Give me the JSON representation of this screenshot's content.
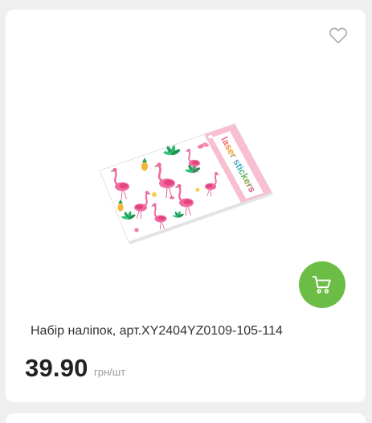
{
  "product": {
    "title": "Набір наліпок, арт.XY2404YZ0109-105-114",
    "price": "39.90",
    "unit": "грн/шт",
    "image_label": "laser stickers"
  },
  "icons": {
    "favorite": "heart-icon",
    "cart": "cart-icon"
  },
  "colors": {
    "page_background": "#efefef",
    "card_background": "#ffffff",
    "accent": "#6cbd45",
    "title": "#333333",
    "price": "#222222",
    "unit": "#9a9a9a",
    "icon_outline": "#aaaaaa"
  }
}
